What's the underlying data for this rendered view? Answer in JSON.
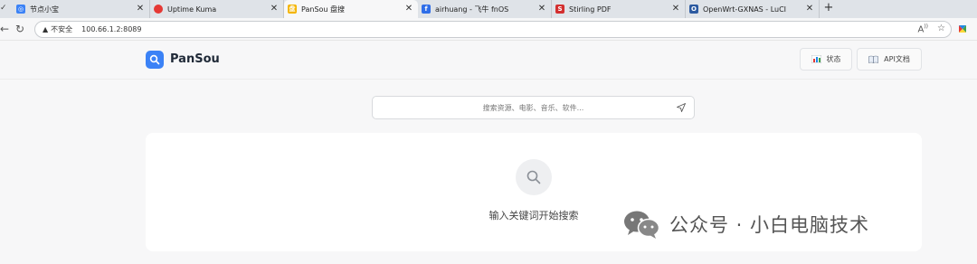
{
  "browser": {
    "tabs": [
      {
        "title": "节点小宝",
        "favicon": "blue-circle-icon",
        "color": "#3b82f6",
        "active": false
      },
      {
        "title": "Uptime Kuma",
        "favicon": "uptime-kuma-icon",
        "color": "#e53935",
        "active": false
      },
      {
        "title": "PanSou 盘搜",
        "favicon": "pansou-icon",
        "color": "#f4b400",
        "active": true
      },
      {
        "title": "airhuang - 飞牛 fnOS",
        "favicon": "fnos-icon",
        "color": "#2f6ee8",
        "active": false
      },
      {
        "title": "Stirling PDF",
        "favicon": "stirling-pdf-icon",
        "color": "#d32f2f",
        "active": false
      },
      {
        "title": "OpenWrt-GXNAS - LuCI",
        "favicon": "openwrt-icon",
        "color": "#2c5aa0",
        "active": false
      }
    ],
    "new_tab": "+",
    "address": {
      "security_label": "不安全",
      "url": "100.66.1.2:8089"
    }
  },
  "app": {
    "brand": "PanSou",
    "brand_color": "#3b82f6",
    "status_button": "状态",
    "api_button": "API文档"
  },
  "search": {
    "placeholder": "搜索资源、电影、音乐、软件..."
  },
  "results": {
    "empty_message": "输入关键词开始搜索"
  },
  "watermark": {
    "text": "公众号 · 小白电脑技术"
  }
}
